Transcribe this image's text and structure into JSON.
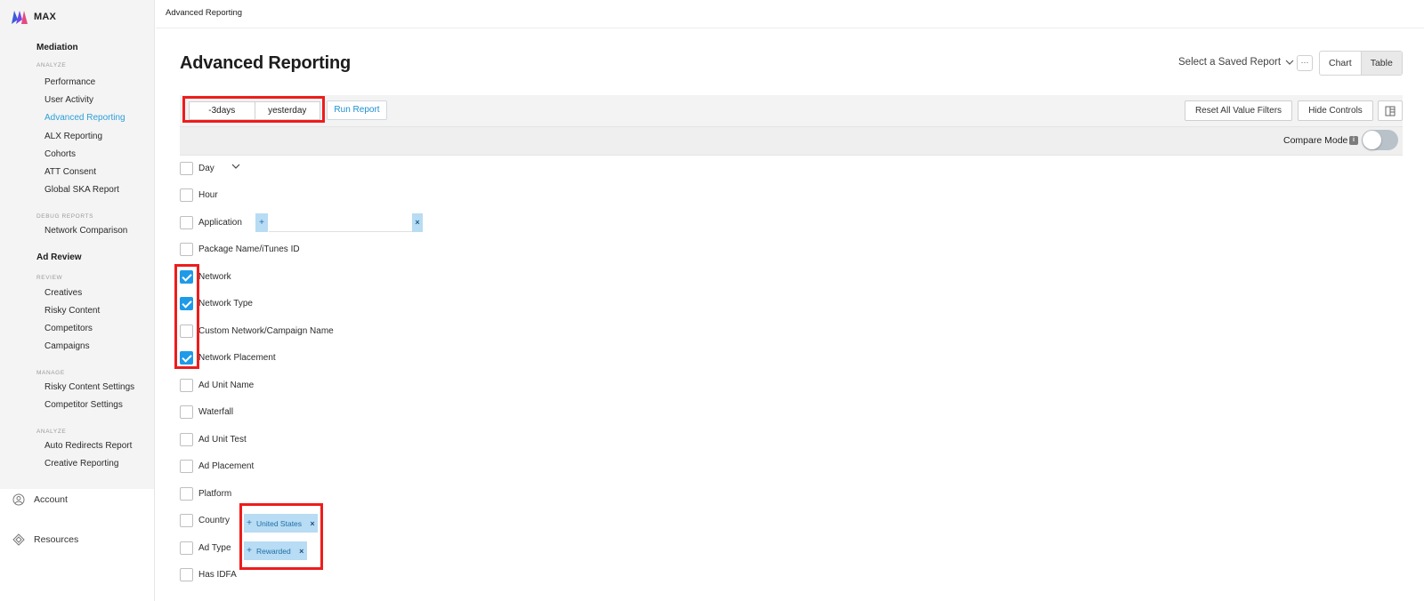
{
  "sidebar": {
    "brand": "MAX",
    "mediation": {
      "title": "Mediation",
      "analyze_label": "ANALYZE",
      "analyze_items": [
        "Performance",
        "User Activity",
        "Advanced Reporting",
        "ALX Reporting",
        "Cohorts",
        "ATT Consent",
        "Global SKA Report"
      ],
      "debug_label": "DEBUG REPORTS",
      "debug_items": [
        "Network Comparison"
      ]
    },
    "ad_review": {
      "title": "Ad Review",
      "review_label": "REVIEW",
      "review_items": [
        "Creatives",
        "Risky Content",
        "Competitors",
        "Campaigns"
      ],
      "manage_label": "MANAGE",
      "manage_items": [
        "Risky Content Settings",
        "Competitor Settings"
      ],
      "analyze_label": "ANALYZE",
      "analyze_items": [
        "Auto Redirects Report",
        "Creative Reporting"
      ]
    },
    "bottom": [
      "Account",
      "Resources"
    ]
  },
  "breadcrumb": "Advanced Reporting",
  "page_title": "Advanced Reporting",
  "saved_report": "Select a Saved Report",
  "more_label": "···",
  "view_toggle": [
    "Chart",
    "Table"
  ],
  "controls": {
    "start_date": "-3days",
    "end_date": "yesterday",
    "run_report": "Run Report",
    "reset_filters": "Reset All Value Filters",
    "hide_controls": "Hide Controls",
    "compare_mode": "Compare Mode",
    "compare_mode_on": false
  },
  "dimensions": [
    {
      "label": "Day",
      "checked": false
    },
    {
      "label": "Hour",
      "checked": false
    },
    {
      "label": "Application",
      "checked": false
    },
    {
      "label": "Package Name/iTunes ID",
      "checked": false
    },
    {
      "label": "Network",
      "checked": true
    },
    {
      "label": "Network Type",
      "checked": true
    },
    {
      "label": "Custom Network/Campaign Name",
      "checked": false
    },
    {
      "label": "Network Placement",
      "checked": true
    },
    {
      "label": "Ad Unit Name",
      "checked": false
    },
    {
      "label": "Waterfall",
      "checked": false
    },
    {
      "label": "Ad Unit Test",
      "checked": false
    },
    {
      "label": "Ad Placement",
      "checked": false
    },
    {
      "label": "Platform",
      "checked": false
    },
    {
      "label": "Country",
      "checked": false
    },
    {
      "label": "Ad Type",
      "checked": false
    },
    {
      "label": "Has IDFA",
      "checked": false
    }
  ],
  "filters": {
    "application_plus": "+",
    "application_remove": "×",
    "country_chip": "United States",
    "ad_type_chip": "Rewarded",
    "chip_plus": "+",
    "chip_remove": "×"
  },
  "colors": {
    "accent": "#2d9fd9",
    "checkbox_on": "#1f9ae8",
    "highlight": "#ee1c1c",
    "chip": "#b7dcf3"
  }
}
